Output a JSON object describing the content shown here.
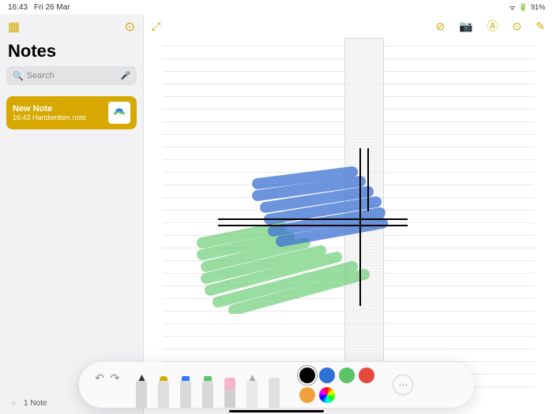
{
  "statusbar": {
    "time": "16:43",
    "date": "Fri 26 Mar",
    "battery": "91%"
  },
  "sidebar": {
    "title": "Notes",
    "search_placeholder": "Search",
    "note": {
      "title": "New Note",
      "subtitle": "16:43  Handwritten note"
    },
    "footer_count": "1 Note"
  },
  "colors": {
    "black": "#000000",
    "blue": "#2f6fd8",
    "green": "#5cc466",
    "red": "#e6483d",
    "orange": "#f2a03b",
    "rainbow": "conic"
  },
  "tools": [
    "pen",
    "marker",
    "highlighter-blue",
    "highlighter-green",
    "eraser",
    "pencil",
    "ruler"
  ]
}
